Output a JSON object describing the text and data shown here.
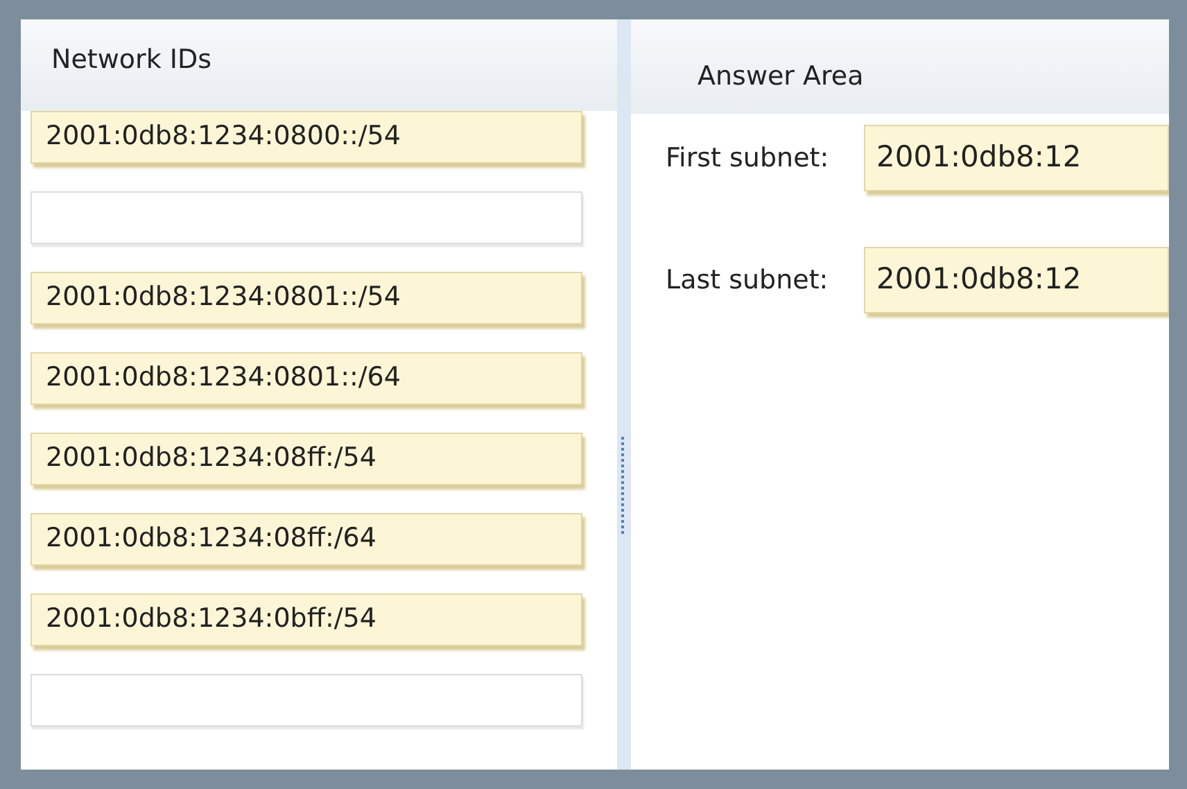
{
  "left_panel": {
    "title": "Network IDs",
    "items": [
      {
        "kind": "tile",
        "text": "2001:0db8:1234:0800::/54"
      },
      {
        "kind": "empty"
      },
      {
        "kind": "tile",
        "text": "2001:0db8:1234:0801::/54"
      },
      {
        "kind": "tile",
        "text": "2001:0db8:1234:0801::/64"
      },
      {
        "kind": "tile",
        "text": "2001:0db8:1234:08ff:/54"
      },
      {
        "kind": "tile",
        "text": "2001:0db8:1234:08ff:/64"
      },
      {
        "kind": "tile",
        "text": "2001:0db8:1234:0bff:/54"
      },
      {
        "kind": "empty"
      }
    ]
  },
  "answer_area": {
    "title": "Answer Area",
    "rows": [
      {
        "label": "First subnet:",
        "value": "2001:0db8:12"
      },
      {
        "label": "Last subnet:",
        "value": "2001:0db8:12"
      }
    ]
  }
}
